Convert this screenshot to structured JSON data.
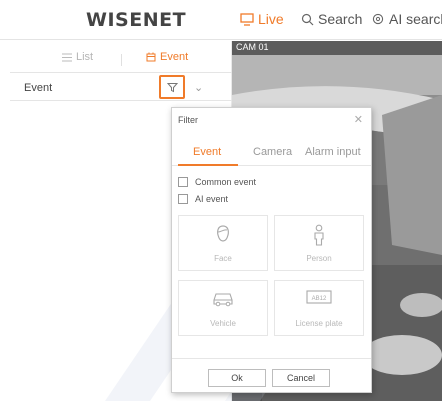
{
  "app": {
    "logo": "WISENET"
  },
  "nav": {
    "live": "Live",
    "search": "Search",
    "ai_search": "AI search"
  },
  "left_panel": {
    "tabs": [
      {
        "label": "List",
        "icon": "list-icon"
      },
      {
        "label": "Event",
        "icon": "event-icon",
        "active": true
      }
    ],
    "event_row_label": "Event"
  },
  "camera": {
    "title": "CAM 01"
  },
  "filter_dialog": {
    "title": "Filter",
    "tabs": [
      {
        "label": "Event",
        "active": true
      },
      {
        "label": "Camera"
      },
      {
        "label": "Alarm input"
      }
    ],
    "checkboxes": [
      {
        "label": "Common event",
        "checked": false
      },
      {
        "label": "AI event",
        "checked": false
      }
    ],
    "ai_types": [
      {
        "label": "Face",
        "icon": "face-icon"
      },
      {
        "label": "Person",
        "icon": "person-icon"
      },
      {
        "label": "Vehicle",
        "icon": "vehicle-icon"
      },
      {
        "label": "License plate",
        "icon": "license-plate-icon",
        "plate_text": "AB12"
      }
    ],
    "ok_label": "Ok",
    "cancel_label": "Cancel"
  },
  "colors": {
    "accent": "#f07b2a",
    "border": "#e4e4e4",
    "muted_text": "#b8b8b8"
  }
}
